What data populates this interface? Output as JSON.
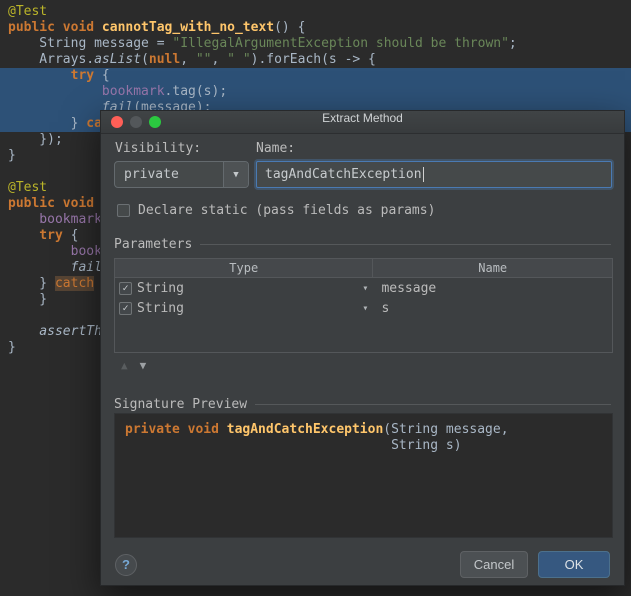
{
  "editor": {
    "lines": [
      [
        [
          "ann",
          "@Test"
        ]
      ],
      [
        [
          "kw",
          "public void "
        ],
        [
          "fn",
          "cannotTag_with_no_text"
        ],
        [
          "pl",
          "() {"
        ]
      ],
      [
        [
          "pl",
          "    String message = "
        ],
        [
          "str",
          "\"IllegalArgumentException should be thrown\""
        ],
        [
          "pl",
          ";"
        ]
      ],
      [
        [
          "pl",
          "    Arrays."
        ],
        [
          "it",
          "asList"
        ],
        [
          "pl",
          "("
        ],
        [
          "kw",
          "null"
        ],
        [
          "pl",
          ", "
        ],
        [
          "str",
          "\"\""
        ],
        [
          "pl",
          ", "
        ],
        [
          "str",
          "\" \""
        ],
        [
          "pl",
          ").forEach(s -> {"
        ]
      ],
      [
        [
          "kw",
          "        try"
        ],
        [
          "pl",
          " {"
        ]
      ],
      [
        [
          "field",
          "            bookmark"
        ],
        [
          "pl",
          ".tag(s);"
        ]
      ],
      [
        [
          "it",
          "            fail"
        ],
        [
          "pl",
          "(message);"
        ]
      ],
      [
        [
          "pl",
          "        } "
        ],
        [
          "kw",
          "catch"
        ]
      ],
      [
        [
          "pl",
          "    });"
        ]
      ],
      [
        [
          "pl",
          "}"
        ]
      ],
      [],
      [
        [
          "ann",
          "@Test"
        ]
      ],
      [
        [
          "kw",
          "public void "
        ]
      ],
      [
        [
          "field",
          "    bookmark"
        ]
      ],
      [
        [
          "kw",
          "    try"
        ],
        [
          "pl",
          " {"
        ]
      ],
      [
        [
          "field",
          "        book"
        ]
      ],
      [
        [
          "it",
          "        fail"
        ]
      ],
      [
        [
          "pl",
          "    } "
        ],
        [
          "hl",
          "catch"
        ]
      ],
      [
        [
          "pl",
          "    }"
        ]
      ],
      [],
      [
        [
          "it",
          "    assertTh"
        ]
      ],
      [
        [
          "pl",
          "}"
        ]
      ]
    ]
  },
  "dialog": {
    "title": "Extract Method",
    "visibility": {
      "label": "Visibility:",
      "value": "private"
    },
    "name": {
      "label": "Name:",
      "value": "tagAndCatchException"
    },
    "static_checkbox": {
      "label": "Declare static (pass fields as params)",
      "checked": false
    },
    "parameters": {
      "section_label": "Parameters",
      "headers": [
        "Type",
        "Name"
      ],
      "rows": [
        {
          "checked": true,
          "type": "String",
          "name": "message"
        },
        {
          "checked": true,
          "type": "String",
          "name": "s"
        }
      ]
    },
    "signature_preview": {
      "section_label": "Signature Preview",
      "lines": [
        [
          [
            "kw",
            "private void "
          ],
          [
            "fn",
            "tagAndCatchException"
          ],
          [
            "pl",
            "(String message,"
          ]
        ],
        [
          [
            "pl",
            "                                  String s)"
          ]
        ]
      ]
    },
    "help_label": "?",
    "cancel_label": "Cancel",
    "ok_label": "OK"
  },
  "colors": {
    "editor_bg": "#2b2b2b",
    "selection_blue": "#2d5177",
    "dialog_bg": "#3c3f41",
    "accent_blue": "#365880",
    "keyword_orange": "#cc7832",
    "string_green": "#6a8759",
    "annotation_yellow": "#bbb529",
    "method_yellow": "#ffc66b",
    "field_purple": "#9876aa",
    "plain_text": "#a9b7c6",
    "close_red": "#ff5f57",
    "zoom_green": "#2bc840"
  }
}
